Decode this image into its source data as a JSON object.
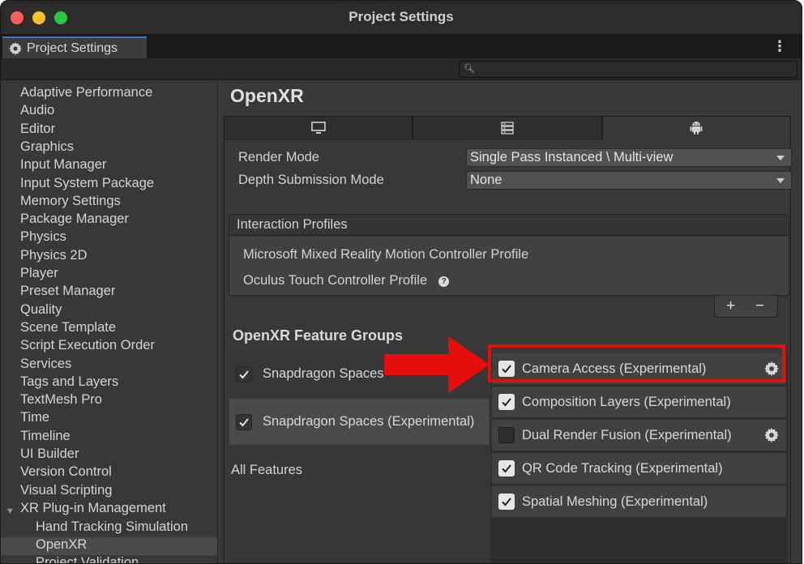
{
  "window": {
    "title": "Project Settings"
  },
  "tab": {
    "label": "Project Settings",
    "icon": "gear-icon"
  },
  "search": {
    "placeholder": ""
  },
  "sidebar": {
    "items": [
      "Adaptive Performance",
      "Audio",
      "Editor",
      "Graphics",
      "Input Manager",
      "Input System Package",
      "Memory Settings",
      "Package Manager",
      "Physics",
      "Physics 2D",
      "Player",
      "Preset Manager",
      "Quality",
      "Scene Template",
      "Script Execution Order",
      "Services",
      "Tags and Layers",
      "TextMesh Pro",
      "Time",
      "Timeline",
      "UI Builder",
      "Version Control",
      "Visual Scripting",
      "XR Plug-in Management"
    ],
    "sub_items": [
      "Hand Tracking Simulation",
      "OpenXR",
      "Project Validation"
    ],
    "selected": "OpenXR"
  },
  "main": {
    "heading": "OpenXR",
    "platform_tabs": [
      {
        "icon": "desktop-icon",
        "active": false
      },
      {
        "icon": "server-icon",
        "active": false
      },
      {
        "icon": "android-icon",
        "active": true
      }
    ],
    "render_mode": {
      "label": "Render Mode",
      "value": "Single Pass Instanced \\ Multi-view"
    },
    "depth_submission": {
      "label": "Depth Submission Mode",
      "value": "None"
    },
    "interaction_profiles": {
      "header": "Interaction Profiles",
      "items": [
        "Microsoft Mixed Reality Motion Controller Profile",
        "Oculus Touch Controller Profile"
      ],
      "add_label": "+",
      "remove_label": "−"
    },
    "feature_groups": {
      "title": "OpenXR Feature Groups",
      "groups": [
        {
          "label": "Snapdragon Spaces",
          "checked": true
        },
        {
          "label": "Snapdragon Spaces (Experimental)",
          "checked": true
        }
      ],
      "all_features": "All Features"
    },
    "features": [
      {
        "label": "Camera Access (Experimental)",
        "checked": true,
        "has_settings": true
      },
      {
        "label": "Composition Layers (Experimental)",
        "checked": true,
        "has_settings": false
      },
      {
        "label": "Dual Render Fusion (Experimental)",
        "checked": false,
        "has_settings": true
      },
      {
        "label": "QR Code Tracking (Experimental)",
        "checked": true,
        "has_settings": false
      },
      {
        "label": "Spatial Meshing (Experimental)",
        "checked": true,
        "has_settings": false
      }
    ]
  },
  "annotation": {
    "highlight_color": "#e60d0d",
    "arrow_color": "#e60d0d"
  }
}
